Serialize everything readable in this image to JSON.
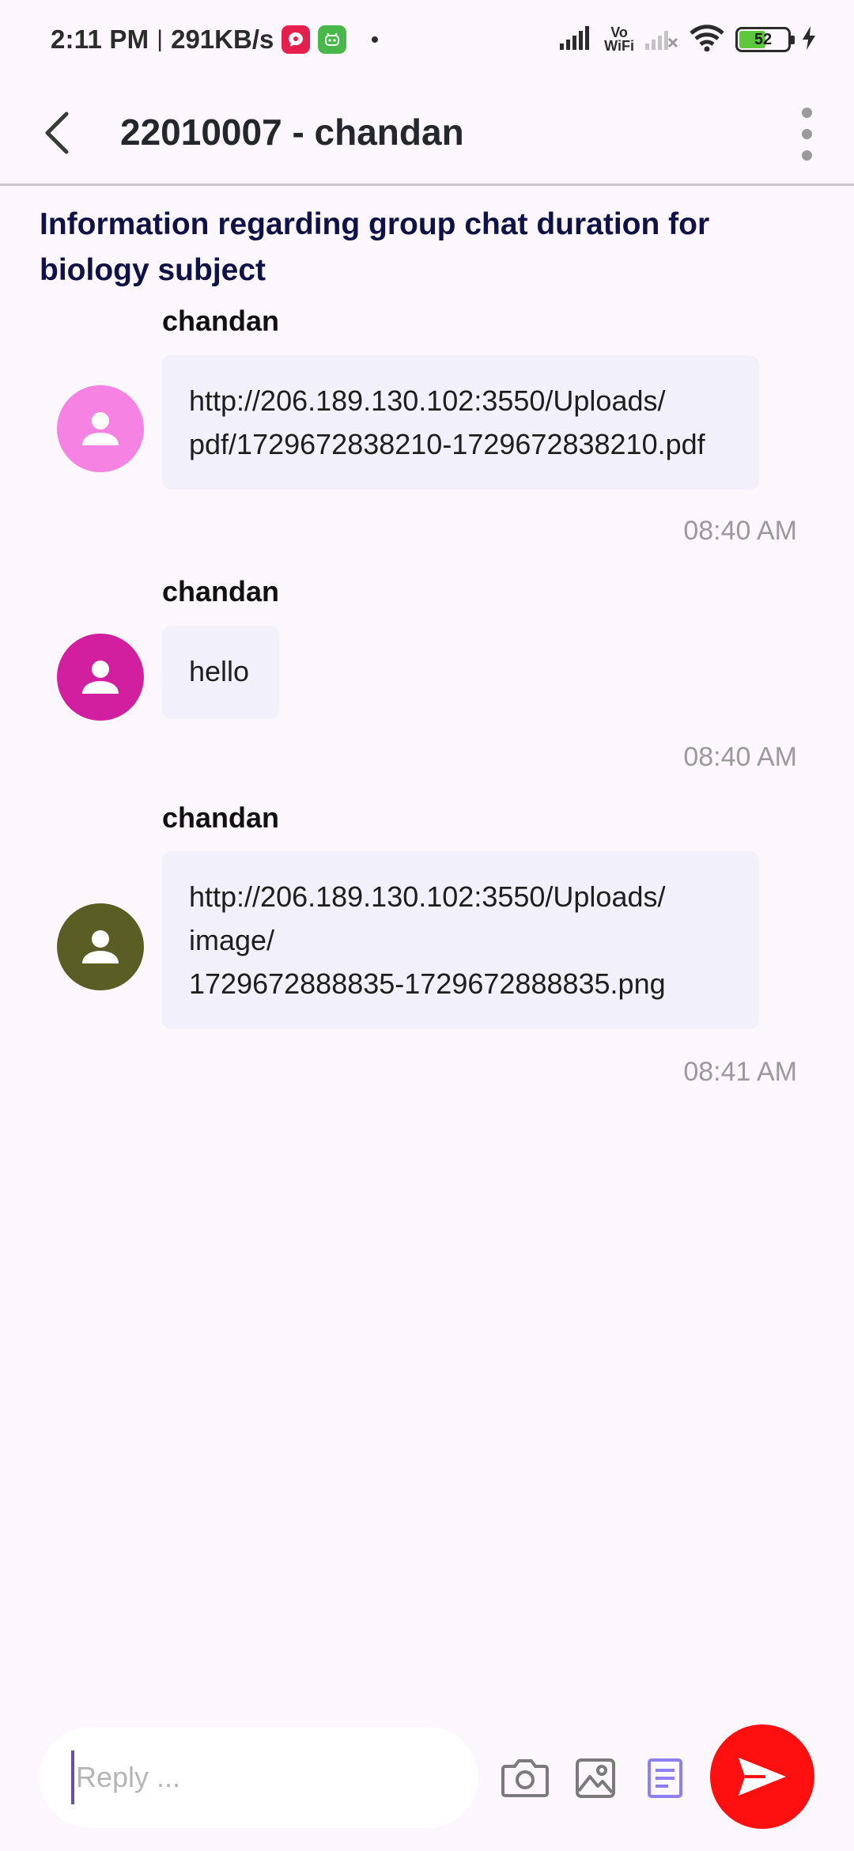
{
  "status_bar": {
    "time": "2:11 PM",
    "separator": "|",
    "network_speed": "291KB/s",
    "vowifi_top": "Vo",
    "vowifi_bottom": "WiFi",
    "battery_level": "52"
  },
  "app_bar": {
    "title": "22010007 - chandan"
  },
  "chat": {
    "subject": "Information regarding group chat duration for biology subject",
    "messages": [
      {
        "sender": "chandan",
        "text": "http://206.189.130.102:3550/Uploads/\npdf/1729672838210-1729672838210.pdf",
        "time": "08:40 AM",
        "avatar_color": "#f683e4"
      },
      {
        "sender": "chandan",
        "text": "hello",
        "time": "08:40 AM",
        "avatar_color": "#d21fa0"
      },
      {
        "sender": "chandan",
        "text": "http://206.189.130.102:3550/Uploads/\nimage/\n1729672888835-1729672888835.png",
        "time": "08:41 AM",
        "avatar_color": "#5a5e24"
      }
    ]
  },
  "composer": {
    "placeholder": "Reply ...",
    "value": ""
  },
  "colors": {
    "background": "#fcf6fd",
    "bubble": "#f1f0fb",
    "send_button": "#ff1010",
    "accent": "#6750a4",
    "subject_text": "#0f1247"
  },
  "icons": {
    "back": "arrow-back-icon",
    "more": "more-vert-icon",
    "avatar": "person-icon",
    "camera": "camera-icon",
    "gallery": "image-icon",
    "document": "document-icon",
    "send": "send-icon"
  }
}
